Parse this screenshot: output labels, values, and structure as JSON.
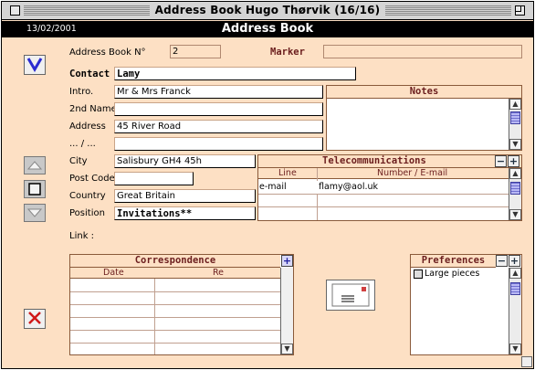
{
  "window": {
    "title": "Address Book Hugo Thørvik (16/16)"
  },
  "header": {
    "date": "13/02/2001",
    "title": "Address Book"
  },
  "form": {
    "address_book_no_label": "Address Book N°",
    "address_book_no": "2",
    "marker_label": "Marker",
    "marker": "",
    "contact_label": "Contact",
    "contact": "Lamy",
    "intro_label": "Intro.",
    "intro": "Mr & Mrs Franck",
    "second_name_label": "2nd Name",
    "second_name": "",
    "address_label": "Address",
    "address": "45 River Road",
    "address2_label": "... / ...",
    "address2": "",
    "city_label": "City",
    "city": "Salisbury GH4 45h",
    "postcode_label": "Post Code",
    "postcode": "",
    "country_label": "Country",
    "country": "Great Britain",
    "position_label": "Position",
    "position": "Invitations**",
    "link_label": "Link :"
  },
  "notes": {
    "title": "Notes",
    "text": ""
  },
  "telecom": {
    "title": "Telecommunications",
    "col_line": "Line",
    "col_number": "Number / E-mail",
    "rows": [
      {
        "line": "e-mail",
        "number": "flamy@aol.uk"
      }
    ]
  },
  "correspondence": {
    "title": "Correspondence",
    "col_date": "Date",
    "col_re": "Re"
  },
  "preferences": {
    "title": "Preferences",
    "items": [
      {
        "label": "Large pieces",
        "checked": false
      }
    ]
  },
  "icons": {
    "check": "checkmark-icon",
    "up": "up-arrow-icon",
    "stop": "square-icon",
    "down": "down-arrow-icon",
    "delete": "x-icon",
    "envelope": "envelope-icon"
  },
  "colors": {
    "background": "#fde0c4",
    "panel_title": "#6b1e1e",
    "check_blue": "#2a2ad0",
    "delete_red": "#d01818"
  }
}
